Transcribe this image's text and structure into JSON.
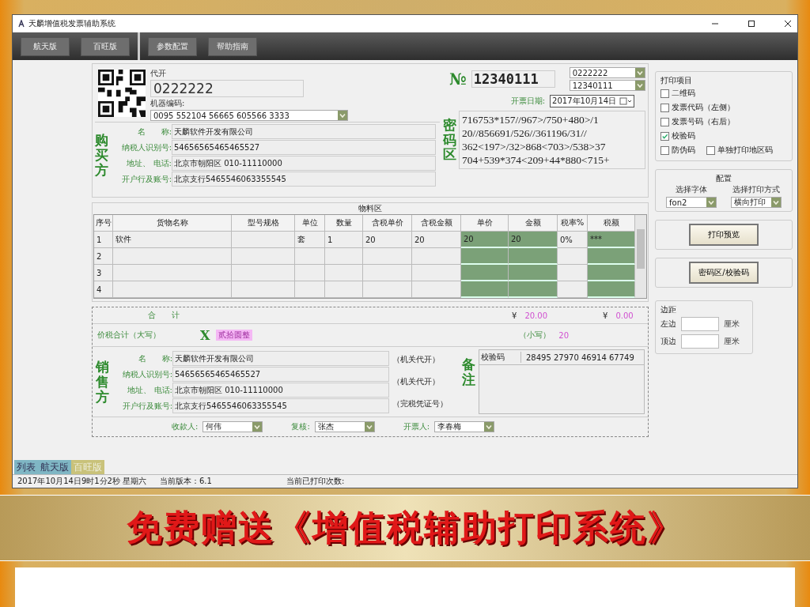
{
  "window": {
    "title": "天麟增值税发票辅助系统"
  },
  "toolbar": {
    "left": [
      {
        "label": "航天版"
      },
      {
        "label": "百旺版"
      }
    ],
    "right": [
      {
        "label": "参数配置"
      },
      {
        "label": "帮助指南"
      }
    ]
  },
  "invoice": {
    "code_label": "代开",
    "code": "0222222",
    "machine_label": "机器编码:",
    "machine_code": "0095 552104 56665 605566 3333",
    "number_mark": "№",
    "number": "12340111",
    "code_combo": "0222222",
    "number_combo": "12340111",
    "date_label": "开票日期:",
    "date": "2017年10月14日",
    "buyer": {
      "title": "购买方",
      "fields": [
        {
          "label": "名　　称:",
          "value": "天麟软件开发有限公司"
        },
        {
          "label": "纳税人识别号:",
          "value": "54656565465465527"
        },
        {
          "label": "地址、 电话:",
          "value": "北京市朝阳区 010-11110000"
        },
        {
          "label": "开户行及账号:",
          "value": "北京支行5465546063355545"
        }
      ]
    },
    "cipher": {
      "title": "密码区",
      "lines": [
        "716753*157//967>/750+480>/1",
        "20//856691/526//361196/31//",
        "362<197>/32>868<703>/538>37",
        "704+539*374<209+44*880<715+"
      ]
    },
    "goods": {
      "title": "物料区",
      "columns": [
        {
          "label": "序号",
          "shaded": false
        },
        {
          "label": "货物名称",
          "shaded": false
        },
        {
          "label": "型号规格",
          "shaded": false
        },
        {
          "label": "单位",
          "shaded": false
        },
        {
          "label": "数量",
          "shaded": false
        },
        {
          "label": "含税单价",
          "shaded": false
        },
        {
          "label": "含税金额",
          "shaded": false
        },
        {
          "label": "单价",
          "shaded": true
        },
        {
          "label": "金额",
          "shaded": true
        },
        {
          "label": "税率%",
          "shaded": false
        },
        {
          "label": "税额",
          "shaded": true
        }
      ],
      "rows": [
        [
          "1",
          "软件",
          "",
          "套",
          "1",
          "20",
          "20",
          "20",
          "20",
          "0%",
          "***"
        ],
        [
          "2",
          "",
          "",
          "",
          "",
          "",
          "",
          "",
          "",
          "",
          ""
        ],
        [
          "3",
          "",
          "",
          "",
          "",
          "",
          "",
          "",
          "",
          "",
          ""
        ],
        [
          "4",
          "",
          "",
          "",
          "",
          "",
          "",
          "",
          "",
          "",
          ""
        ]
      ]
    },
    "totals": {
      "label": "合　　计",
      "amount": "¥",
      "amount_value": "20.00",
      "tax": "¥",
      "tax_value": "0.00"
    },
    "grand": {
      "label": "价税合计（大写）",
      "mark": "X",
      "words": "贰拾圆整",
      "small_label": "（小写）",
      "small_value": "20"
    },
    "seller": {
      "title": "销售方",
      "fields": [
        {
          "label": "名　　称:",
          "value": "天麟软件开发有限公司"
        },
        {
          "label": "纳税人识别号:",
          "value": "54656565465465527"
        },
        {
          "label": "地址、 电话:",
          "value": "北京市朝阳区 010-11110000"
        },
        {
          "label": "开户行及账号:",
          "value": "北京支行5465546063355545"
        }
      ],
      "notes": [
        "（机关代开）",
        "（机关代开）",
        "（完税凭证号）"
      ]
    },
    "remarks": {
      "title": "备注",
      "check_label": "校验码",
      "check_code": "28495 27970 46914 67749"
    },
    "signers": [
      {
        "label": "收款人:",
        "value": "何伟"
      },
      {
        "label": "复核:",
        "value": "张杰"
      },
      {
        "label": "开票人:",
        "value": "李春梅"
      }
    ]
  },
  "print_items": {
    "title": "打印项目",
    "items": [
      {
        "label": "二维码",
        "checked": false
      },
      {
        "label": "发票代码（左侧）",
        "checked": false
      },
      {
        "label": "发票号码（右后）",
        "checked": false
      },
      {
        "label": "校验码",
        "checked": true
      },
      {
        "label": "防伪码",
        "checked": false
      },
      {
        "label": "单独打印地区码",
        "checked": false
      }
    ]
  },
  "config": {
    "title": "配置",
    "font_label": "选择字体",
    "font": "fon2",
    "mode_label": "选择打印方式",
    "mode": "横向打印"
  },
  "buttons": [
    {
      "label": "打印预览"
    },
    {
      "label": "密码区/校验码"
    }
  ],
  "margins": {
    "title": "边距",
    "rows": [
      {
        "label": "左边",
        "unit": "厘米"
      },
      {
        "label": "顶边",
        "unit": "厘米"
      }
    ]
  },
  "bottom_tabs": [
    {
      "label": "列表",
      "selected": false
    },
    {
      "label": "航天版",
      "selected": false
    },
    {
      "label": "百旺版",
      "selected": true
    }
  ],
  "status_bar": [
    "2017年10月14日9时1分2秒  星期六",
    "当前版本：6.1",
    "当前已打印次数:"
  ],
  "banner": "免费赠送《增值税辅助打印系统》"
}
